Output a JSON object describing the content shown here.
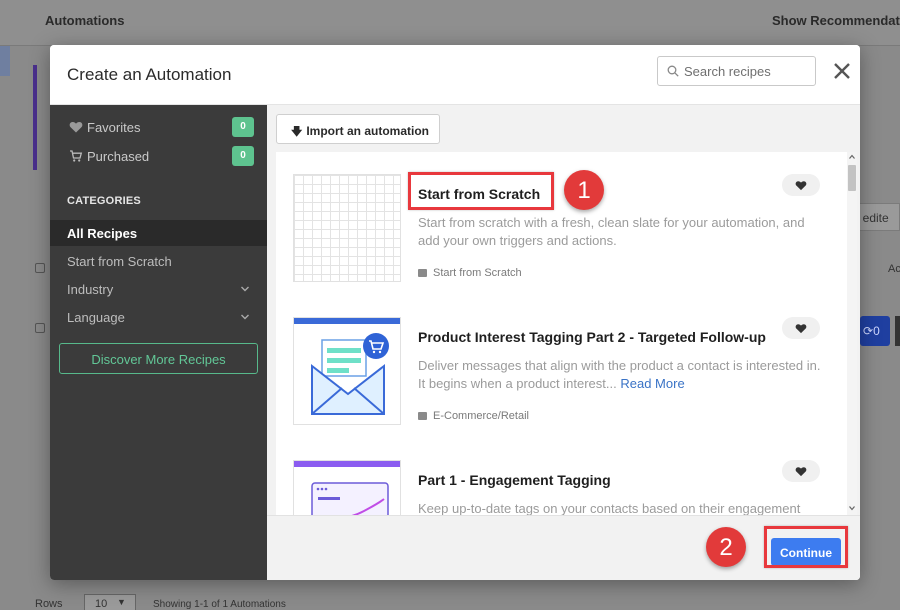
{
  "background": {
    "title": "Automations",
    "show_recommendations": "Show Recommendations",
    "last_edited": "st edite",
    "ac_label": "Ac",
    "row_count_label": "0",
    "rows_label": "Rows",
    "rows_value": "10",
    "showing_text": "Showing 1-1 of 1 Automations"
  },
  "modal": {
    "title": "Create an Automation",
    "search_placeholder": "Search recipes"
  },
  "sidebar": {
    "favorites": {
      "label": "Favorites",
      "count": "0"
    },
    "purchased": {
      "label": "Purchased",
      "count": "0"
    },
    "categories_heading": "CATEGORIES",
    "items": [
      {
        "label": "All Recipes",
        "active": true
      },
      {
        "label": "Start from Scratch",
        "active": false
      },
      {
        "label": "Industry",
        "active": false
      },
      {
        "label": "Language",
        "active": false
      }
    ],
    "discover_label": "Discover More Recipes"
  },
  "content": {
    "import_label": "Import an automation",
    "recipes": [
      {
        "title": "Start from Scratch",
        "description": "Start from scratch with a fresh, clean slate for your automation, and add your own triggers and actions.",
        "category": "Start from Scratch"
      },
      {
        "title": "Product Interest Tagging Part 2 - Targeted Follow-up",
        "description": "Deliver messages that align with the product a contact is interested in. It begins when a product interest...",
        "read_more": "Read More",
        "category": "E-Commerce/Retail"
      },
      {
        "title": "Part 1 - Engagement Tagging",
        "description": "Keep up-to-date tags on your contacts based on their engagement level."
      }
    ],
    "continue_label": "Continue"
  },
  "annotations": {
    "marker_1": "1",
    "marker_2": "2"
  },
  "colors": {
    "accent_green": "#5ec38f",
    "continue_blue": "#3d7cf0",
    "highlight_red": "#e8383d",
    "sidebar_bg": "#3b3b3b"
  }
}
